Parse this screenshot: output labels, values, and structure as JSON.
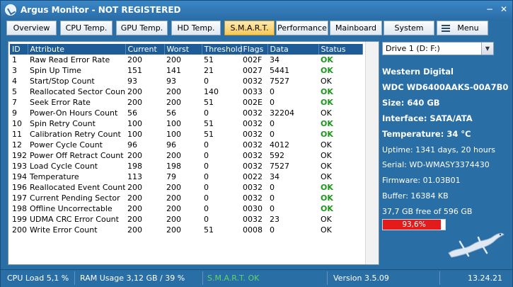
{
  "window": {
    "title": "Argus Monitor - NOT REGISTERED"
  },
  "tabs": [
    {
      "label": "Overview"
    },
    {
      "label": "CPU Temp."
    },
    {
      "label": "GPU Temp."
    },
    {
      "label": "HD Temp."
    },
    {
      "label": "S.M.A.R.T."
    },
    {
      "label": "Performance"
    },
    {
      "label": "Mainboard"
    },
    {
      "label": "System"
    },
    {
      "label": "Menu"
    }
  ],
  "active_tab": "S.M.A.R.T.",
  "smart_table": {
    "columns": [
      "ID",
      "Attribute",
      "Current",
      "Worst",
      "Threshold",
      "Flags",
      "Data",
      "Status"
    ],
    "rows": [
      [
        "1",
        "Raw Read Error Rate",
        "200",
        "200",
        "51",
        "002F",
        "34",
        "OK"
      ],
      [
        "3",
        "Spin Up Time",
        "151",
        "141",
        "21",
        "0027",
        "5441",
        "OK"
      ],
      [
        "4",
        "Start/Stop Count",
        "93",
        "93",
        "0",
        "0032",
        "7527",
        "OK"
      ],
      [
        "5",
        "Reallocated Sector Count",
        "200",
        "200",
        "140",
        "0033",
        "0",
        "OK"
      ],
      [
        "7",
        "Seek Error Rate",
        "200",
        "200",
        "51",
        "002E",
        "0",
        "OK"
      ],
      [
        "9",
        "Power-On Hours Count",
        "56",
        "56",
        "0",
        "0032",
        "32204",
        "OK"
      ],
      [
        "10",
        "Spin Retry Count",
        "100",
        "100",
        "51",
        "0032",
        "0",
        "OK"
      ],
      [
        "11",
        "Calibration Retry Count",
        "100",
        "100",
        "51",
        "0032",
        "0",
        "OK"
      ],
      [
        "12",
        "Power Cycle Count",
        "96",
        "96",
        "0",
        "0032",
        "4012",
        "OK"
      ],
      [
        "192",
        "Power Off Retract Count",
        "200",
        "200",
        "0",
        "0032",
        "592",
        "OK"
      ],
      [
        "193",
        "Load Cycle Count",
        "198",
        "198",
        "0",
        "0032",
        "7527",
        "OK"
      ],
      [
        "194",
        "Temperature",
        "113",
        "79",
        "0",
        "0022",
        "34",
        "OK"
      ],
      [
        "196",
        "Reallocated Event Count",
        "200",
        "200",
        "0",
        "0032",
        "0",
        "OK"
      ],
      [
        "197",
        "Current Pending Sector",
        "200",
        "200",
        "0",
        "0032",
        "0",
        "OK"
      ],
      [
        "198",
        "Offline Uncorrectable",
        "200",
        "200",
        "0",
        "0030",
        "0",
        "OK"
      ],
      [
        "199",
        "UDMA CRC Error Count",
        "200",
        "200",
        "0",
        "0032",
        "23",
        "OK"
      ],
      [
        "200",
        "Write Error Count",
        "200",
        "200",
        "51",
        "0008",
        "0",
        "OK"
      ]
    ],
    "status_colors": {
      "ok_green": "#1a9a1a",
      "ok_plain": "#000000"
    }
  },
  "drive_info": {
    "selected_drive": "Drive 1 (D: F:)",
    "vendor": "Western Digital",
    "model": "WDC WD6400AAKS-00A7B0",
    "size": "Size: 640 GB",
    "interface": "Interface: SATA/ATA",
    "temperature": "Temperature: 34 °C",
    "uptime": "Uptime: 1341 days, 20 hours",
    "serial": "Serial: WD-WMASY3374430",
    "firmware": "Firmware: 01.03B01",
    "buffer": "Buffer: 16384 KB",
    "free_space": "37,7 GB free of 596 GB",
    "usage_label": "93,6%",
    "usage_fraction": 0.936,
    "usage_color": "#e41b1b"
  },
  "statusbar": {
    "cpu": "CPU Load 5,1 %",
    "ram": "RAM Usage 3,12 GB / 39 %",
    "smart": "S.M.A.R.T. OK",
    "smart_color": "#5fd36a",
    "version": "Version 3.5.09",
    "time": "13.24.21"
  },
  "icons": {
    "app": "argus-app-icon",
    "menu": "hamburger-menu-icon",
    "logo": "lizard-logo",
    "window_buttons": [
      "minimize-icon",
      "close-icon"
    ]
  }
}
